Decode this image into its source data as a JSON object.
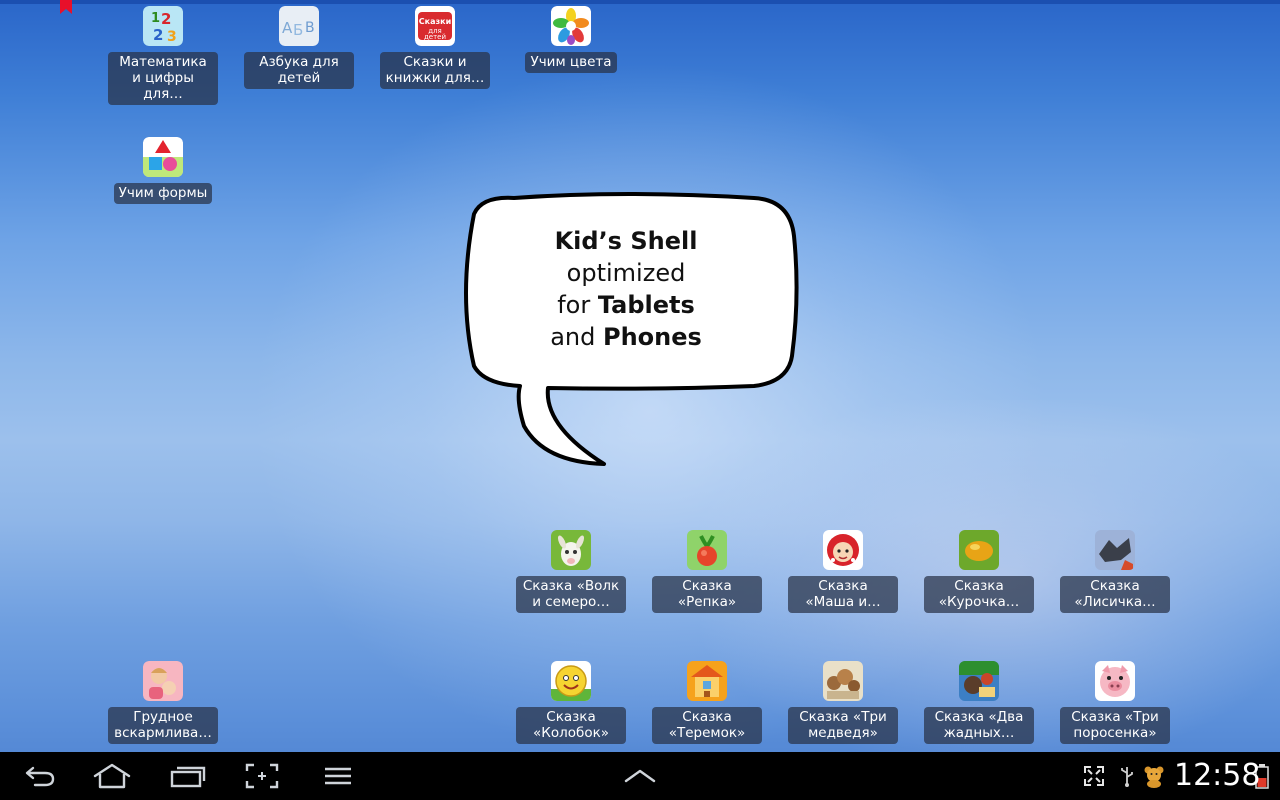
{
  "desktop": {
    "apps": [
      {
        "label": "Математика и цифры для…",
        "icon": "numbers-icon"
      },
      {
        "label": "Азбука для детей",
        "icon": "alphabet-icon"
      },
      {
        "label": "Сказки и книжки для…",
        "icon": "fairytales-books-icon"
      },
      {
        "label": "Учим цвета",
        "icon": "colors-flower-icon"
      },
      {
        "label": "Учим формы",
        "icon": "shapes-icon"
      },
      {
        "label": "Грудное вскармлива…",
        "icon": "breastfeeding-icon"
      }
    ],
    "stories_row1": [
      {
        "label": "Сказка «Волк и семеро…",
        "icon": "goat-icon"
      },
      {
        "label": "Сказка «Репка»",
        "icon": "turnip-icon"
      },
      {
        "label": "Сказка «Маша и…",
        "icon": "masha-icon"
      },
      {
        "label": "Сказка «Курочка…",
        "icon": "golden-egg-icon"
      },
      {
        "label": "Сказка «Лисичка…",
        "icon": "fox-icon"
      }
    ],
    "stories_row2": [
      {
        "label": "Сказка «Колобок»",
        "icon": "kolobok-icon"
      },
      {
        "label": "Сказка «Теремок»",
        "icon": "teremok-house-icon"
      },
      {
        "label": "Сказка «Три медведя»",
        "icon": "three-bears-icon"
      },
      {
        "label": "Сказка «Два жадных…",
        "icon": "two-bears-icon"
      },
      {
        "label": "Сказка «Три поросенка»",
        "icon": "pig-icon"
      }
    ]
  },
  "promo": {
    "line1": "Kid’s Shell",
    "line2": "optimized",
    "line3_prefix": "for ",
    "line3_bold": "Tablets",
    "line4_prefix": "and ",
    "line4_bold": "Phones"
  },
  "navbar": {
    "clock": "12:58",
    "buttons": [
      "back-icon",
      "home-icon",
      "recent-apps-icon",
      "screenshot-icon",
      "menu-icon",
      "chevron-up-icon"
    ],
    "status_icons": [
      "fullscreen-icon",
      "usb-icon",
      "teddy-bear-icon",
      "battery-icon"
    ]
  },
  "colors": {
    "label_bg": "#283246",
    "navbar_bg": "#000000",
    "bookmark": "#e8102a"
  }
}
